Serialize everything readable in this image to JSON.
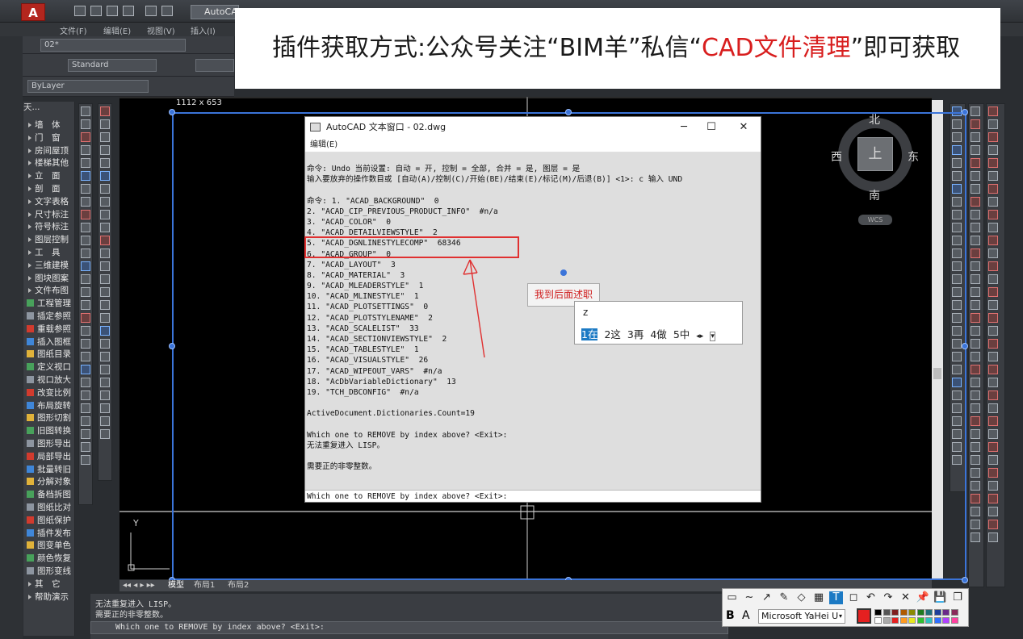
{
  "window": {
    "title_tab": "AutoCAD",
    "menu": [
      "文件(F)",
      "编辑(E)",
      "视图(V)",
      "插入(I)"
    ]
  },
  "toolbar": {
    "layer_box": "02*",
    "style_box": "Standard",
    "name_box": "ByLayer"
  },
  "banner": {
    "prefix": "插件获取方式:公众号关注“BIM羊”私信“",
    "red": "CAD文件清理",
    "suffix": "”即可获取"
  },
  "viewport": {
    "size_label": "1112 x 653",
    "compass": {
      "north": "北",
      "south": "南",
      "east": "东",
      "west": "西",
      "top": "上",
      "wcs": "WCS"
    },
    "ucs_y": "Y"
  },
  "left_panel": {
    "header": "天...",
    "items": [
      "墙　体",
      "门　窗",
      "房间屋顶",
      "楼梯其他",
      "立　面",
      "剖　面",
      "文字表格",
      "尺寸标注",
      "符号标注",
      "图层控制",
      "工　具",
      "三维建模",
      "图块图案",
      "文件布图",
      "工程管理",
      "插定参照",
      "重载参照",
      "插入图框",
      "图纸目录",
      "定义视口",
      "视口放大",
      "改变比例",
      "布局旋转",
      "图形切割",
      "旧图转换",
      "图形导出",
      "局部导出",
      "批量转旧",
      "分解对象",
      "备档拆图",
      "图纸比对",
      "图纸保护",
      "插件发布",
      "图变单色",
      "颜色恢复",
      "图形变线",
      "其　它",
      "帮助演示"
    ]
  },
  "text_window": {
    "title": "AutoCAD 文本窗口 - 02.dwg",
    "menu": "编辑(E)",
    "lines": [
      "命令: Undo 当前设置: 自动 = 开, 控制 = 全部, 合并 = 是, 图层 = 是",
      "输入要放弃的操作数目或 [自动(A)/控制(C)/开始(BE)/结束(E)/标记(M)/后退(B)] <1>: c 输入 UND",
      "",
      "命令: 1. \"ACAD_BACKGROUND\"  0",
      "2. \"ACAD_CIP_PREVIOUS_PRODUCT_INFO\"  #n/a",
      "3. \"ACAD_COLOR\"  0",
      "4. \"ACAD_DETAILVIEWSTYLE\"  2",
      "5. \"ACAD_DGNLINESTYLECOMP\"  68346",
      "6. \"ACAD_GROUP\"  0",
      "7. \"ACAD_LAYOUT\"  3",
      "8. \"ACAD_MATERIAL\"  3",
      "9. \"ACAD_MLEADERSTYLE\"  1",
      "10. \"ACAD_MLINESTYLE\"  1",
      "11. \"ACAD_PLOTSETTINGS\"  0",
      "12. \"ACAD_PLOTSTYLENAME\"  2",
      "13. \"ACAD_SCALELIST\"  33",
      "14. \"ACAD_SECTIONVIEWSTYLE\"  2",
      "15. \"ACAD_TABLESTYLE\"  1",
      "16. \"ACAD_VISUALSTYLE\"  26",
      "17. \"ACAD_WIPEOUT_VARS\"  #n/a",
      "18. \"AcDbVariableDictionary\"  13",
      "19. \"TCH_DBCONFIG\"  #n/a",
      "",
      "ActiveDocument.Dictionaries.Count=19",
      "",
      "Which one to REMOVE by index above? <Exit>:",
      "无法重复进入 LISP。",
      "",
      "需要正的非零整数。"
    ],
    "input_line": "Which one to REMOVE by index above? <Exit>:"
  },
  "mtext_label": "我到后面述职",
  "ime": {
    "pinyin": "z",
    "candidates": [
      "1在",
      "2这",
      "3再",
      "4做",
      "5中"
    ]
  },
  "layout_tabs": [
    "模型",
    "布局1",
    "布局2"
  ],
  "cmdline": {
    "history": [
      "无法重复进入 LISP。",
      "需要正的非零整数。"
    ],
    "prompt": "Which one to REMOVE by index above? <Exit>:"
  },
  "annotation_toolbar": {
    "font": "Microsoft YaHei U",
    "bold": "B",
    "italic_a": "A",
    "tools": [
      "▭",
      "∼",
      "↗",
      "✎",
      "◇",
      "▦",
      "T",
      "◻",
      "↶",
      "↷",
      "✕",
      "📌",
      "💾",
      "❐"
    ],
    "active_tool": "T",
    "accent": "#1c7ac4",
    "current_color": "#e52020"
  },
  "colors": {
    "highlight": "#e03030",
    "selection": "#3b74d9",
    "banner_red": "#d81e1e"
  }
}
